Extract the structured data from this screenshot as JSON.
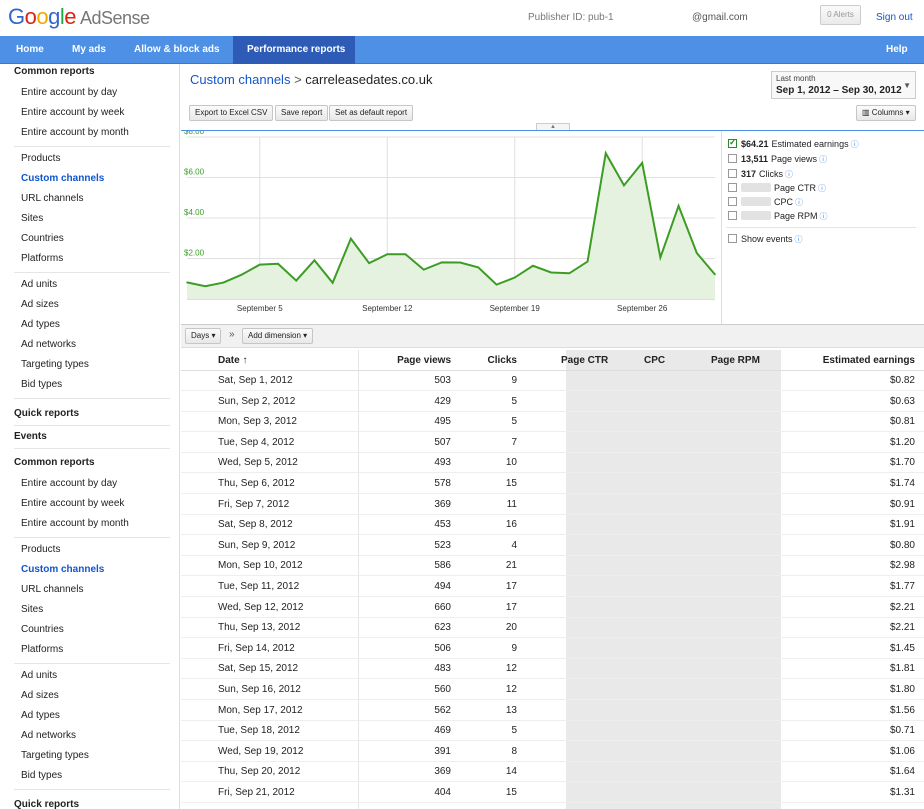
{
  "header": {
    "logo_google": [
      "G",
      "o",
      "o",
      "g",
      "l",
      "e"
    ],
    "logo_product": "AdSense",
    "publisher_id": "Publisher ID: pub-1",
    "email": "@gmail.com",
    "alerts": "0 Alerts",
    "signout": "Sign out"
  },
  "nav": {
    "items": [
      "Home",
      "My ads",
      "Allow & block ads",
      "Performance reports"
    ],
    "active": "Performance reports",
    "help": "Help"
  },
  "sidebar": {
    "sections": [
      {
        "heading": "Common reports",
        "items": [
          "Entire account by day",
          "Entire account by week",
          "Entire account by month"
        ]
      },
      {
        "items": [
          "Products",
          "Custom channels",
          "URL channels",
          "Sites",
          "Countries",
          "Platforms"
        ],
        "active": "Custom channels"
      },
      {
        "items": [
          "Ad units",
          "Ad sizes",
          "Ad types",
          "Ad networks",
          "Targeting types",
          "Bid types"
        ]
      },
      {
        "heading": "Quick reports"
      },
      {
        "heading": "Events"
      }
    ]
  },
  "breadcrumb": {
    "parent": "Custom channels",
    "separator": ">",
    "current": "carreleasedates.co.uk"
  },
  "date_range": {
    "label": "Last month",
    "value": "Sep 1, 2012 – Sep 30, 2012"
  },
  "toolbar": {
    "export": "Export to Excel CSV",
    "save": "Save report",
    "set_default": "Set as default report",
    "columns": "Columns"
  },
  "legend": {
    "items": [
      {
        "value": "$64.21",
        "label": "Estimated earnings",
        "checked": true
      },
      {
        "value": "13,511",
        "label": "Page views",
        "checked": false
      },
      {
        "value": "317",
        "label": "Clicks",
        "checked": false
      },
      {
        "value": "",
        "label": "Page CTR",
        "checked": false,
        "blurred": true
      },
      {
        "value": "",
        "label": "CPC",
        "checked": false,
        "blurred": true
      },
      {
        "value": "",
        "label": "Page RPM",
        "checked": false,
        "blurred": true
      }
    ],
    "show_events": "Show events"
  },
  "dimension_bar": {
    "days": "Days",
    "add_dimension": "Add dimension"
  },
  "chart_data": {
    "type": "area",
    "series": [
      {
        "values": [
          0.82,
          0.63,
          0.81,
          1.2,
          1.7,
          1.74,
          0.91,
          1.91,
          0.8,
          2.98,
          1.77,
          2.21,
          2.21,
          1.45,
          1.81,
          1.8,
          1.56,
          0.71,
          1.06,
          1.64,
          1.31,
          1.27,
          1.85,
          7.2,
          5.61,
          6.72,
          2.05,
          4.6,
          2.27,
          1.21
        ]
      }
    ],
    "x": [
      1,
      2,
      3,
      4,
      5,
      6,
      7,
      8,
      9,
      10,
      11,
      12,
      13,
      14,
      15,
      16,
      17,
      18,
      19,
      20,
      21,
      22,
      23,
      24,
      25,
      26,
      27,
      28,
      29,
      30
    ],
    "x_tick_labels": [
      "September 5",
      "September 12",
      "September 19",
      "September 26"
    ],
    "x_ticks": [
      5,
      12,
      19,
      26
    ],
    "y_tick_labels": [
      "$8.00",
      "$6.00",
      "$4.00",
      "$2.00"
    ],
    "y_ticks": [
      8,
      6,
      4,
      2
    ],
    "ylim": [
      0,
      8
    ],
    "grid": true,
    "line_color": "#3c9c24",
    "fill_color": "#e6f2e0"
  },
  "table": {
    "headers": {
      "date": "Date ↑",
      "pv": "Page views",
      "clicks": "Clicks",
      "ctr": "Page CTR",
      "cpc": "CPC",
      "rpm": "Page RPM",
      "earnings": "Estimated earnings"
    },
    "rows": [
      [
        "Sat, Sep 1, 2012",
        "503",
        "9",
        "$0.82"
      ],
      [
        "Sun, Sep 2, 2012",
        "429",
        "5",
        "$0.63"
      ],
      [
        "Mon, Sep 3, 2012",
        "495",
        "5",
        "$0.81"
      ],
      [
        "Tue, Sep 4, 2012",
        "507",
        "7",
        "$1.20"
      ],
      [
        "Wed, Sep 5, 2012",
        "493",
        "10",
        "$1.70"
      ],
      [
        "Thu, Sep 6, 2012",
        "578",
        "15",
        "$1.74"
      ],
      [
        "Fri, Sep 7, 2012",
        "369",
        "11",
        "$0.91"
      ],
      [
        "Sat, Sep 8, 2012",
        "453",
        "16",
        "$1.91"
      ],
      [
        "Sun, Sep 9, 2012",
        "523",
        "4",
        "$0.80"
      ],
      [
        "Mon, Sep 10, 2012",
        "586",
        "21",
        "$2.98"
      ],
      [
        "Tue, Sep 11, 2012",
        "494",
        "17",
        "$1.77"
      ],
      [
        "Wed, Sep 12, 2012",
        "660",
        "17",
        "$2.21"
      ],
      [
        "Thu, Sep 13, 2012",
        "623",
        "20",
        "$2.21"
      ],
      [
        "Fri, Sep 14, 2012",
        "506",
        "9",
        "$1.45"
      ],
      [
        "Sat, Sep 15, 2012",
        "483",
        "12",
        "$1.81"
      ],
      [
        "Sun, Sep 16, 2012",
        "560",
        "12",
        "$1.80"
      ],
      [
        "Mon, Sep 17, 2012",
        "562",
        "13",
        "$1.56"
      ],
      [
        "Tue, Sep 18, 2012",
        "469",
        "5",
        "$0.71"
      ],
      [
        "Wed, Sep 19, 2012",
        "391",
        "8",
        "$1.06"
      ],
      [
        "Thu, Sep 20, 2012",
        "369",
        "14",
        "$1.64"
      ],
      [
        "Fri, Sep 21, 2012",
        "404",
        "15",
        "$1.31"
      ]
    ]
  }
}
